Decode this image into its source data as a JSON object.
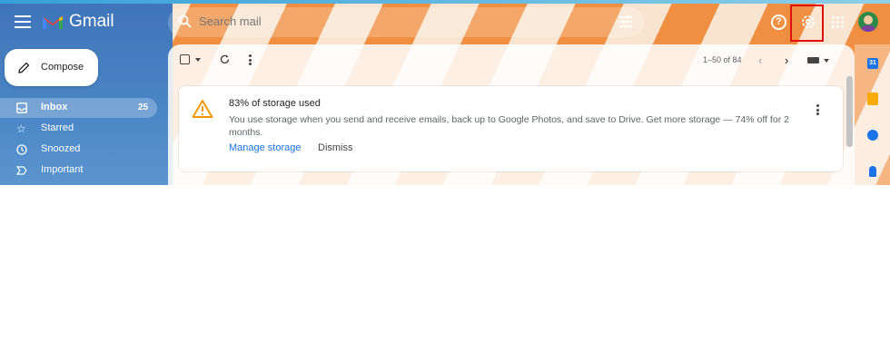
{
  "header": {
    "app_name": "Gmail",
    "search_placeholder": "Search mail",
    "help_symbol": "?"
  },
  "sidebar": {
    "compose_label": "Compose",
    "items": [
      {
        "label": "Inbox",
        "count": "25",
        "icon": "inbox-icon",
        "active": true
      },
      {
        "label": "Starred",
        "count": "",
        "icon": "star-icon",
        "active": false
      },
      {
        "label": "Snoozed",
        "count": "",
        "icon": "clock-icon",
        "active": false
      },
      {
        "label": "Important",
        "count": "",
        "icon": "important-icon",
        "active": false
      }
    ]
  },
  "toolbar": {
    "pagination": "1–50 of 84"
  },
  "storage_alert": {
    "title": "83% of storage used",
    "body": "You use storage when you send and receive emails, back up to Google Photos, and save to Drive. Get more storage — 74% off for 2 months.",
    "manage_label": "Manage storage",
    "dismiss_label": "Dismiss"
  },
  "side_panel": {
    "calendar_day": "31"
  },
  "colors": {
    "accent_blue": "#1a73e8",
    "warning_orange": "#f29900",
    "highlight_red": "#e01010"
  }
}
